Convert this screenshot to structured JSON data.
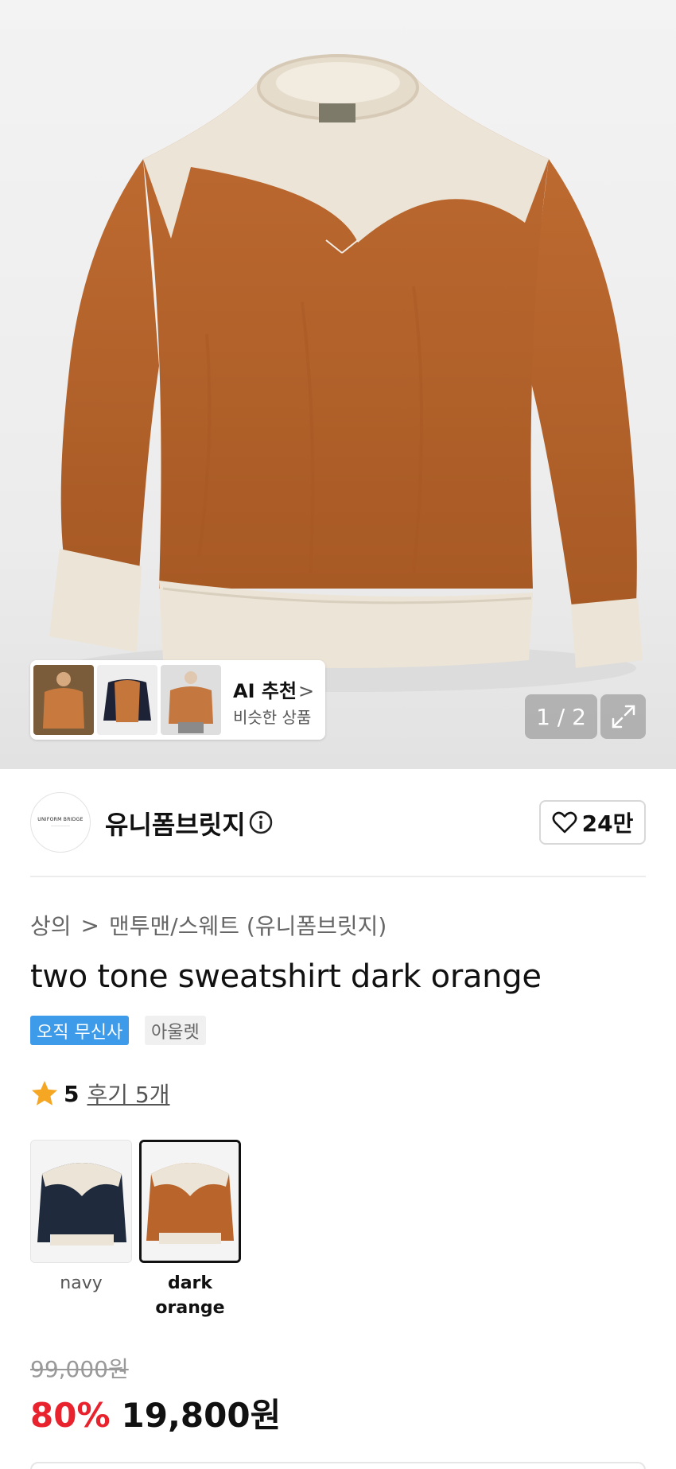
{
  "hero": {
    "ai_recommend": {
      "title": "AI 추천",
      "chevron": ">",
      "subtitle": "비슷한 상품"
    },
    "page_indicator": "1 / 2",
    "expand_icon": "expand-arrows-icon"
  },
  "brand": {
    "logo_text": "UNIFORM BRIDGE",
    "name": "유니폼브릿지",
    "info_icon": "info-icon",
    "like_count": "24만",
    "like_icon": "heart-outline-icon"
  },
  "breadcrumb": {
    "category": "상의",
    "separator": ">",
    "subcategory": "맨투맨/스웨트 (유니폼브릿지)"
  },
  "product": {
    "title": "two tone sweatshirt dark orange",
    "badges": [
      "오직 무신사",
      "아울렛"
    ],
    "rating": {
      "icon": "star-icon",
      "score": "5",
      "reviews": "후기 5개"
    },
    "colors": [
      {
        "label": "navy",
        "selected": false
      },
      {
        "label": "dark orange",
        "selected": true
      }
    ],
    "original_price": "99,000원",
    "discount": "80%",
    "price": "19,800원"
  },
  "colors": {
    "accent_blue": "#3d9be9",
    "discount_red": "#e8232e",
    "sweatshirt_orange": "#b8642b",
    "sweatshirt_cream": "#ece4d6",
    "navy": "#1f2a3c"
  }
}
